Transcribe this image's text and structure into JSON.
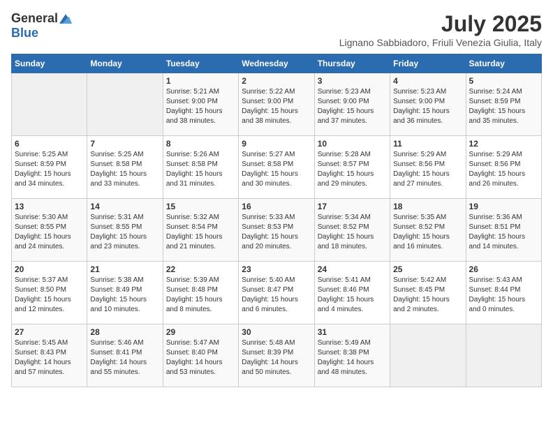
{
  "logo": {
    "general": "General",
    "blue": "Blue"
  },
  "title": "July 2025",
  "subtitle": "Lignano Sabbiadoro, Friuli Venezia Giulia, Italy",
  "days_of_week": [
    "Sunday",
    "Monday",
    "Tuesday",
    "Wednesday",
    "Thursday",
    "Friday",
    "Saturday"
  ],
  "weeks": [
    [
      {
        "day": "",
        "empty": true
      },
      {
        "day": "",
        "empty": true
      },
      {
        "day": "1",
        "sunrise": "5:21 AM",
        "sunset": "9:00 PM",
        "daylight": "15 hours and 38 minutes."
      },
      {
        "day": "2",
        "sunrise": "5:22 AM",
        "sunset": "9:00 PM",
        "daylight": "15 hours and 38 minutes."
      },
      {
        "day": "3",
        "sunrise": "5:23 AM",
        "sunset": "9:00 PM",
        "daylight": "15 hours and 37 minutes."
      },
      {
        "day": "4",
        "sunrise": "5:23 AM",
        "sunset": "9:00 PM",
        "daylight": "15 hours and 36 minutes."
      },
      {
        "day": "5",
        "sunrise": "5:24 AM",
        "sunset": "8:59 PM",
        "daylight": "15 hours and 35 minutes."
      }
    ],
    [
      {
        "day": "6",
        "sunrise": "5:25 AM",
        "sunset": "8:59 PM",
        "daylight": "15 hours and 34 minutes."
      },
      {
        "day": "7",
        "sunrise": "5:25 AM",
        "sunset": "8:58 PM",
        "daylight": "15 hours and 33 minutes."
      },
      {
        "day": "8",
        "sunrise": "5:26 AM",
        "sunset": "8:58 PM",
        "daylight": "15 hours and 31 minutes."
      },
      {
        "day": "9",
        "sunrise": "5:27 AM",
        "sunset": "8:58 PM",
        "daylight": "15 hours and 30 minutes."
      },
      {
        "day": "10",
        "sunrise": "5:28 AM",
        "sunset": "8:57 PM",
        "daylight": "15 hours and 29 minutes."
      },
      {
        "day": "11",
        "sunrise": "5:29 AM",
        "sunset": "8:56 PM",
        "daylight": "15 hours and 27 minutes."
      },
      {
        "day": "12",
        "sunrise": "5:29 AM",
        "sunset": "8:56 PM",
        "daylight": "15 hours and 26 minutes."
      }
    ],
    [
      {
        "day": "13",
        "sunrise": "5:30 AM",
        "sunset": "8:55 PM",
        "daylight": "15 hours and 24 minutes."
      },
      {
        "day": "14",
        "sunrise": "5:31 AM",
        "sunset": "8:55 PM",
        "daylight": "15 hours and 23 minutes."
      },
      {
        "day": "15",
        "sunrise": "5:32 AM",
        "sunset": "8:54 PM",
        "daylight": "15 hours and 21 minutes."
      },
      {
        "day": "16",
        "sunrise": "5:33 AM",
        "sunset": "8:53 PM",
        "daylight": "15 hours and 20 minutes."
      },
      {
        "day": "17",
        "sunrise": "5:34 AM",
        "sunset": "8:52 PM",
        "daylight": "15 hours and 18 minutes."
      },
      {
        "day": "18",
        "sunrise": "5:35 AM",
        "sunset": "8:52 PM",
        "daylight": "15 hours and 16 minutes."
      },
      {
        "day": "19",
        "sunrise": "5:36 AM",
        "sunset": "8:51 PM",
        "daylight": "15 hours and 14 minutes."
      }
    ],
    [
      {
        "day": "20",
        "sunrise": "5:37 AM",
        "sunset": "8:50 PM",
        "daylight": "15 hours and 12 minutes."
      },
      {
        "day": "21",
        "sunrise": "5:38 AM",
        "sunset": "8:49 PM",
        "daylight": "15 hours and 10 minutes."
      },
      {
        "day": "22",
        "sunrise": "5:39 AM",
        "sunset": "8:48 PM",
        "daylight": "15 hours and 8 minutes."
      },
      {
        "day": "23",
        "sunrise": "5:40 AM",
        "sunset": "8:47 PM",
        "daylight": "15 hours and 6 minutes."
      },
      {
        "day": "24",
        "sunrise": "5:41 AM",
        "sunset": "8:46 PM",
        "daylight": "15 hours and 4 minutes."
      },
      {
        "day": "25",
        "sunrise": "5:42 AM",
        "sunset": "8:45 PM",
        "daylight": "15 hours and 2 minutes."
      },
      {
        "day": "26",
        "sunrise": "5:43 AM",
        "sunset": "8:44 PM",
        "daylight": "15 hours and 0 minutes."
      }
    ],
    [
      {
        "day": "27",
        "sunrise": "5:45 AM",
        "sunset": "8:43 PM",
        "daylight": "14 hours and 57 minutes."
      },
      {
        "day": "28",
        "sunrise": "5:46 AM",
        "sunset": "8:41 PM",
        "daylight": "14 hours and 55 minutes."
      },
      {
        "day": "29",
        "sunrise": "5:47 AM",
        "sunset": "8:40 PM",
        "daylight": "14 hours and 53 minutes."
      },
      {
        "day": "30",
        "sunrise": "5:48 AM",
        "sunset": "8:39 PM",
        "daylight": "14 hours and 50 minutes."
      },
      {
        "day": "31",
        "sunrise": "5:49 AM",
        "sunset": "8:38 PM",
        "daylight": "14 hours and 48 minutes."
      },
      {
        "day": "",
        "empty": true
      },
      {
        "day": "",
        "empty": true
      }
    ]
  ]
}
